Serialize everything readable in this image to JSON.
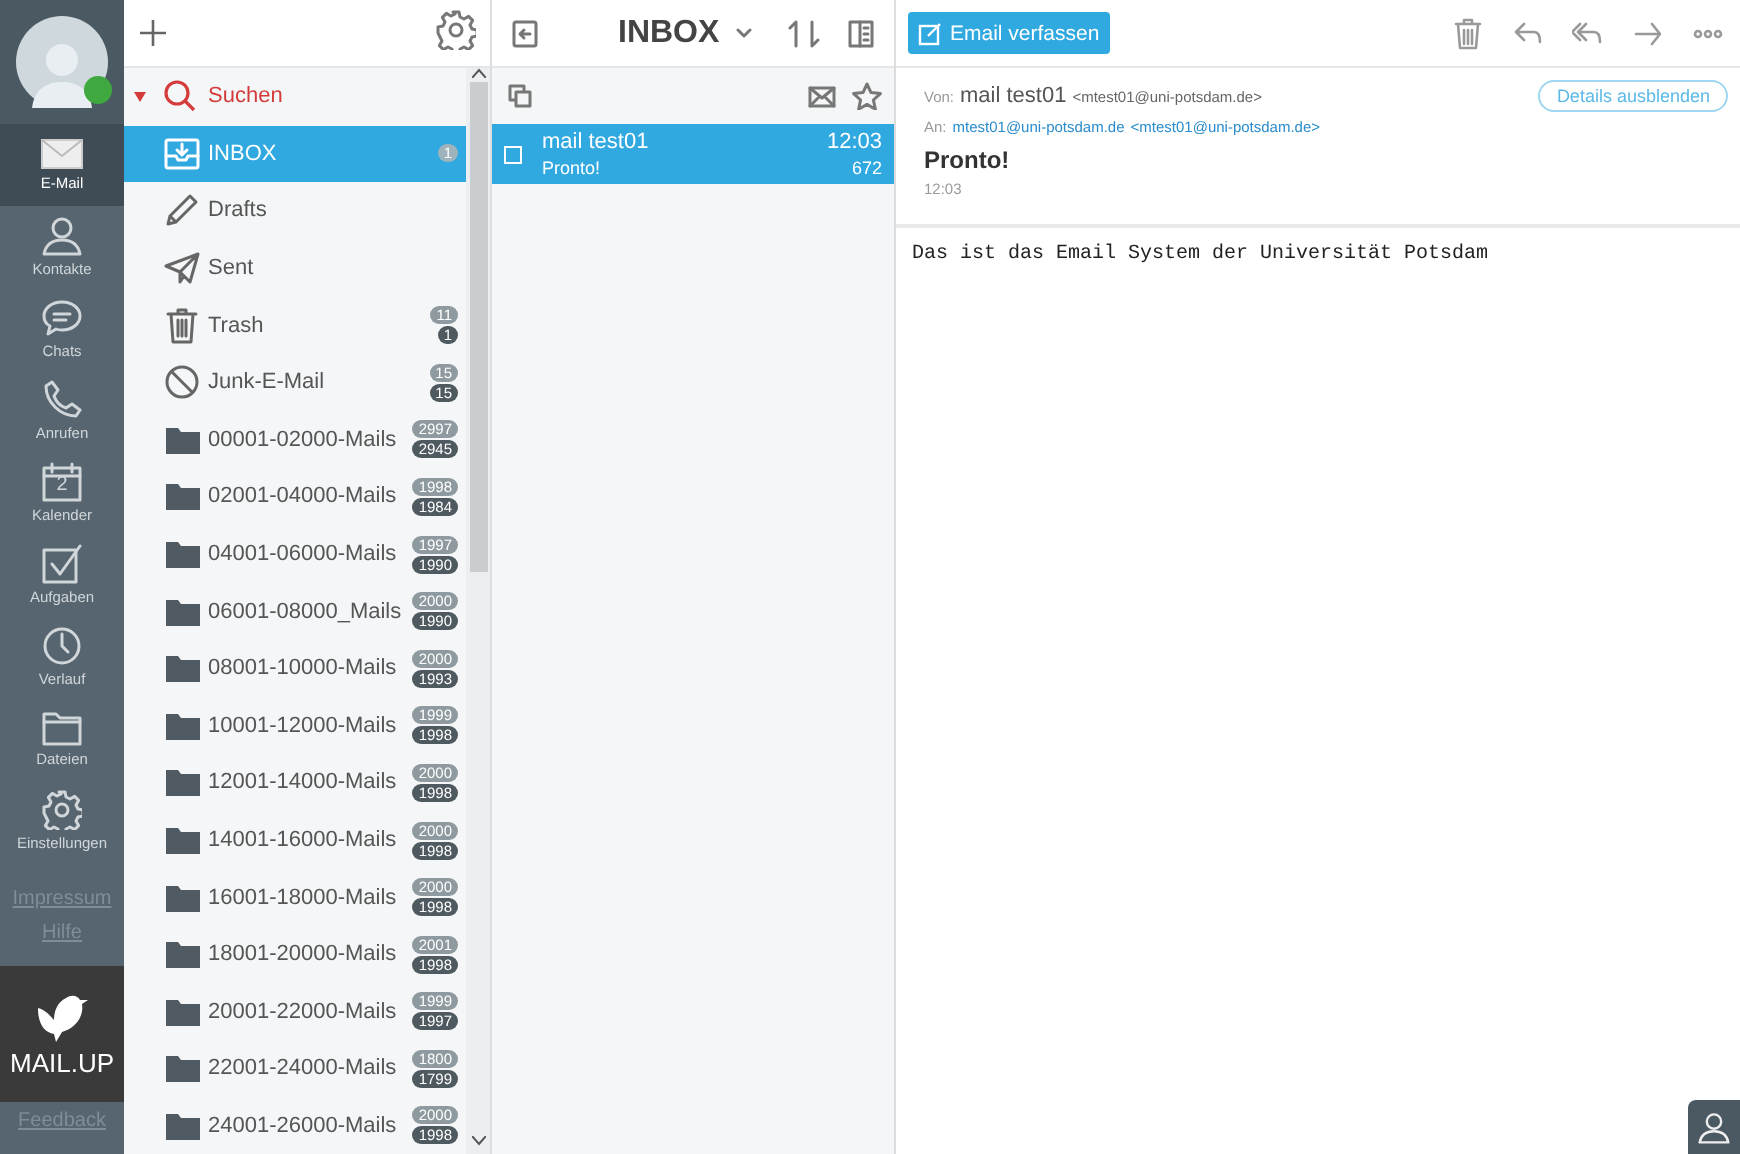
{
  "nav": {
    "avatar": {
      "online": true
    },
    "items": [
      {
        "kind": "mail",
        "label": "E-Mail",
        "selected": true
      },
      {
        "kind": "contacts",
        "label": "Kontakte",
        "selected": false
      },
      {
        "kind": "chats",
        "label": "Chats",
        "selected": false
      },
      {
        "kind": "calls",
        "label": "Anrufen",
        "selected": false
      },
      {
        "kind": "calendar",
        "label": "Kalender",
        "selected": false,
        "day": "2"
      },
      {
        "kind": "tasks",
        "label": "Aufgaben",
        "selected": false
      },
      {
        "kind": "history",
        "label": "Verlauf",
        "selected": false
      },
      {
        "kind": "files",
        "label": "Dateien",
        "selected": false
      },
      {
        "kind": "settings",
        "label": "Einstellungen",
        "selected": false
      }
    ],
    "links": [
      "Impressum",
      "Hilfe"
    ],
    "logo": "MAIL.UP",
    "feedback": "Feedback"
  },
  "folders": {
    "search": {
      "label": "Suchen",
      "expanded": true
    },
    "items": [
      {
        "kind": "inbox",
        "name": "INBOX",
        "selected": true,
        "counts": [
          "1"
        ]
      },
      {
        "kind": "drafts",
        "name": "Drafts",
        "selected": false
      },
      {
        "kind": "sent",
        "name": "Sent",
        "selected": false
      },
      {
        "kind": "trash",
        "name": "Trash",
        "selected": false,
        "counts": [
          "11",
          "1"
        ]
      },
      {
        "kind": "junk",
        "name": "Junk-E-Mail",
        "selected": false,
        "counts": [
          "15",
          "15"
        ]
      },
      {
        "kind": "folder",
        "name": "00001-02000-Mails",
        "selected": false,
        "counts": [
          "2997",
          "2945"
        ]
      },
      {
        "kind": "folder",
        "name": "02001-04000-Mails",
        "selected": false,
        "counts": [
          "1998",
          "1984"
        ]
      },
      {
        "kind": "folder",
        "name": "04001-06000-Mails",
        "selected": false,
        "counts": [
          "1997",
          "1990"
        ]
      },
      {
        "kind": "folder",
        "name": "06001-08000_Mails",
        "selected": false,
        "counts": [
          "2000",
          "1990"
        ]
      },
      {
        "kind": "folder",
        "name": "08001-10000-Mails",
        "selected": false,
        "counts": [
          "2000",
          "1993"
        ]
      },
      {
        "kind": "folder",
        "name": "10001-12000-Mails",
        "selected": false,
        "counts": [
          "1999",
          "1998"
        ]
      },
      {
        "kind": "folder",
        "name": "12001-14000-Mails",
        "selected": false,
        "counts": [
          "2000",
          "1998"
        ]
      },
      {
        "kind": "folder",
        "name": "14001-16000-Mails",
        "selected": false,
        "counts": [
          "2000",
          "1998"
        ]
      },
      {
        "kind": "folder",
        "name": "16001-18000-Mails",
        "selected": false,
        "counts": [
          "2000",
          "1998"
        ]
      },
      {
        "kind": "folder",
        "name": "18001-20000-Mails",
        "selected": false,
        "counts": [
          "2001",
          "1998"
        ]
      },
      {
        "kind": "folder",
        "name": "20001-22000-Mails",
        "selected": false,
        "counts": [
          "1999",
          "1997"
        ]
      },
      {
        "kind": "folder",
        "name": "22001-24000-Mails",
        "selected": false,
        "counts": [
          "1800",
          "1799"
        ]
      },
      {
        "kind": "folder",
        "name": "24001-26000-Mails",
        "selected": false,
        "counts": [
          "2000",
          "1998"
        ]
      }
    ]
  },
  "message_list": {
    "title": "INBOX",
    "messages": [
      {
        "sender": "mail test01",
        "subject": "Pronto!",
        "time": "12:03",
        "size": "672",
        "selected": true,
        "checked": false
      }
    ]
  },
  "reader": {
    "compose": "Email verfassen",
    "from_label": "Von:",
    "from_name": "mail test01",
    "from_address": "<mtest01@uni-potsdam.de>",
    "details_button": "Details ausblenden",
    "to_label": "An:",
    "to_name": "mtest01@uni-potsdam.de",
    "to_address": "<mtest01@uni-potsdam.de>",
    "subject": "Pronto!",
    "time": "12:03",
    "body": "Das ist das Email System der Universität Potsdam"
  }
}
